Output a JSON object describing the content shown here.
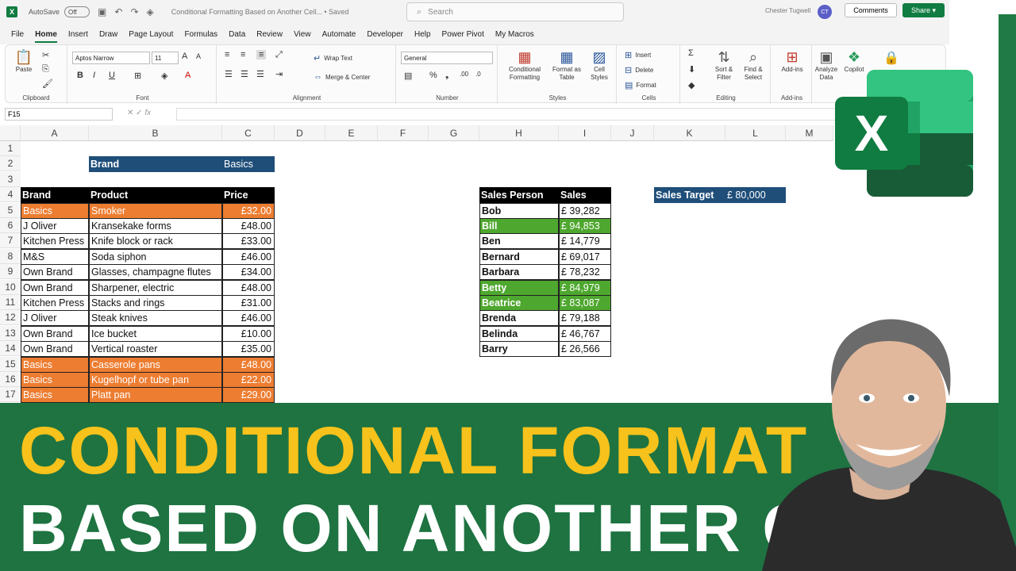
{
  "titlebar": {
    "autosave_label": "AutoSave",
    "autosave_state": "Off",
    "doc_title": "Conditional Formatting Based on Another Cell... • Saved",
    "search_placeholder": "Search",
    "user_name": "Chester Tugwell",
    "user_initials": "CT"
  },
  "menu": {
    "tabs": [
      "File",
      "Home",
      "Insert",
      "Draw",
      "Page Layout",
      "Formulas",
      "Data",
      "Review",
      "View",
      "Automate",
      "Developer",
      "Help",
      "Power Pivot",
      "My Macros"
    ],
    "comments": "Comments",
    "share": "Share"
  },
  "ribbon": {
    "clipboard": {
      "paste": "Paste",
      "label": "Clipboard"
    },
    "font": {
      "name": "Aptos Narrow",
      "size": "11",
      "label": "Font"
    },
    "alignment": {
      "wrap": "Wrap Text",
      "merge": "Merge & Center",
      "label": "Alignment"
    },
    "number": {
      "format": "General",
      "label": "Number"
    },
    "styles": {
      "conditional": "Conditional Formatting",
      "format_table": "Format as Table",
      "cell_styles": "Cell Styles",
      "label": "Styles"
    },
    "cells": {
      "insert": "Insert",
      "delete": "Delete",
      "format": "Format",
      "label": "Cells"
    },
    "editing": {
      "sort": "Sort & Filter",
      "find": "Find & Select",
      "label": "Editing"
    },
    "addins": {
      "addins": "Add-ins",
      "label": "Add-ins"
    },
    "analyze": "Analyze Data",
    "copilot": "Copilot"
  },
  "formula_bar": {
    "name_box": "F15",
    "fx": "fx",
    "content": ""
  },
  "columns": [
    "A",
    "B",
    "C",
    "D",
    "E",
    "F",
    "G",
    "H",
    "I",
    "J",
    "K",
    "L",
    "M"
  ],
  "rows": [
    "1",
    "2",
    "3",
    "4",
    "5",
    "6",
    "7",
    "8",
    "9",
    "10",
    "11",
    "12",
    "13",
    "14",
    "15",
    "16",
    "17"
  ],
  "criteria": {
    "brand_label": "Brand",
    "brand_value": "Basics"
  },
  "product_table": {
    "headers": [
      "Brand",
      "Product",
      "Price"
    ],
    "rows": [
      {
        "brand": "Basics",
        "product": "Smoker",
        "price": "£32.00",
        "highlight": true
      },
      {
        "brand": "J Oliver",
        "product": "Kransekake forms",
        "price": "£48.00",
        "highlight": false
      },
      {
        "brand": "Kitchen Press",
        "product": "Knife block or rack",
        "price": "£33.00",
        "highlight": false
      },
      {
        "brand": "M&S",
        "product": "Soda siphon",
        "price": "£46.00",
        "highlight": false
      },
      {
        "brand": "Own Brand",
        "product": "Glasses, champagne flutes",
        "price": "£34.00",
        "highlight": false
      },
      {
        "brand": "Own Brand",
        "product": "Sharpener, electric",
        "price": "£48.00",
        "highlight": false
      },
      {
        "brand": "Kitchen Press",
        "product": "Stacks and rings",
        "price": "£31.00",
        "highlight": false
      },
      {
        "brand": "J Oliver",
        "product": "Steak knives",
        "price": "£46.00",
        "highlight": false
      },
      {
        "brand": "Own Brand",
        "product": "Ice bucket",
        "price": "£10.00",
        "highlight": false
      },
      {
        "brand": "Own Brand",
        "product": "Vertical roaster",
        "price": "£35.00",
        "highlight": false
      },
      {
        "brand": "Basics",
        "product": "Casserole pans",
        "price": "£48.00",
        "highlight": true
      },
      {
        "brand": "Basics",
        "product": "Kugelhopf or tube pan",
        "price": "£22.00",
        "highlight": true
      },
      {
        "brand": "Basics",
        "product": "Platt pan",
        "price": "£29.00",
        "highlight": true
      }
    ]
  },
  "sales_table": {
    "headers": [
      "Sales Person",
      "Sales"
    ],
    "rows": [
      {
        "name": "Bob",
        "sales": "£ 39,282",
        "highlight": false
      },
      {
        "name": "Bill",
        "sales": "£ 94,853",
        "highlight": true
      },
      {
        "name": "Ben",
        "sales": "£ 14,779",
        "highlight": false
      },
      {
        "name": "Bernard",
        "sales": "£ 69,017",
        "highlight": false
      },
      {
        "name": "Barbara",
        "sales": "£ 78,232",
        "highlight": false
      },
      {
        "name": "Betty",
        "sales": "£ 84,979",
        "highlight": true
      },
      {
        "name": "Beatrice",
        "sales": "£ 83,087",
        "highlight": true
      },
      {
        "name": "Brenda",
        "sales": "£ 79,188",
        "highlight": false
      },
      {
        "name": "Belinda",
        "sales": "£ 46,767",
        "highlight": false
      },
      {
        "name": "Barry",
        "sales": "£ 26,566",
        "highlight": false
      }
    ]
  },
  "target": {
    "label": "Sales Target",
    "value": "£   80,000"
  },
  "banner": {
    "line1": "CONDITIONAL FORMAT",
    "line2": "BASED ON ANOTHER CELL"
  },
  "colors": {
    "excel_green": "#107c41",
    "banner_green": "#1e7341",
    "banner_yellow": "#f6c21b",
    "highlight_orange": "#ed7d31",
    "highlight_green": "#4ea72e",
    "header_blue": "#1f4e79"
  }
}
